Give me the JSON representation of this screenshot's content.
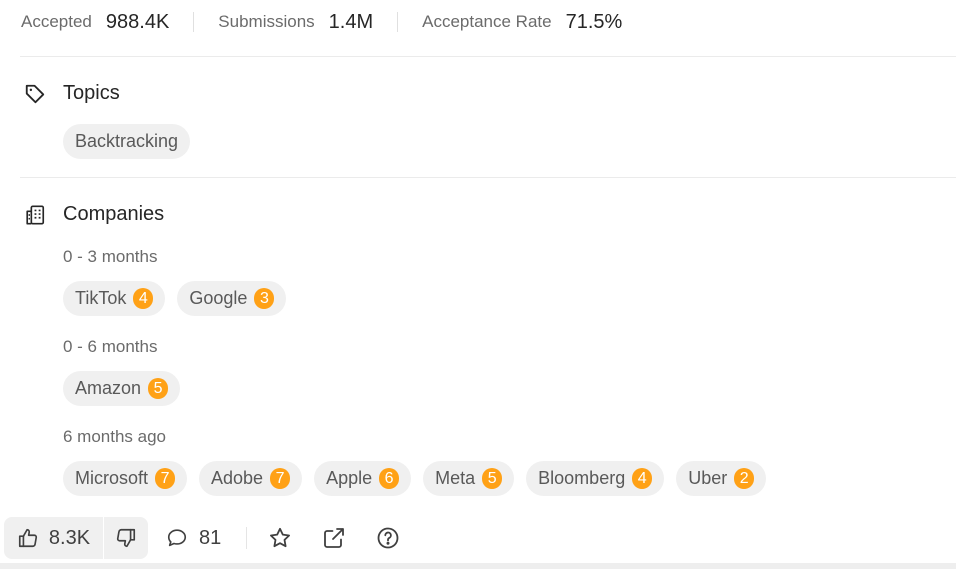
{
  "stats": [
    {
      "label": "Accepted",
      "value": "988.4K"
    },
    {
      "label": "Submissions",
      "value": "1.4M"
    },
    {
      "label": "Acceptance Rate",
      "value": "71.5%"
    }
  ],
  "topics": {
    "title": "Topics",
    "icon": "tag-icon",
    "tags": [
      "Backtracking"
    ]
  },
  "companies": {
    "title": "Companies",
    "icon": "building-icon",
    "groups": [
      {
        "period": "0 - 3 months",
        "items": [
          {
            "name": "TikTok",
            "count": "4"
          },
          {
            "name": "Google",
            "count": "3"
          }
        ]
      },
      {
        "period": "0 - 6 months",
        "items": [
          {
            "name": "Amazon",
            "count": "5"
          }
        ]
      },
      {
        "period": "6 months ago",
        "items": [
          {
            "name": "Microsoft",
            "count": "7"
          },
          {
            "name": "Adobe",
            "count": "7"
          },
          {
            "name": "Apple",
            "count": "6"
          },
          {
            "name": "Meta",
            "count": "5"
          },
          {
            "name": "Bloomberg",
            "count": "4"
          },
          {
            "name": "Uber",
            "count": "2"
          }
        ]
      }
    ]
  },
  "footer": {
    "likes": "8.3K",
    "comments": "81",
    "icons": [
      "thumbs-up-icon",
      "thumbs-down-icon",
      "comment-icon",
      "star-icon",
      "share-icon",
      "help-icon"
    ]
  },
  "colors": {
    "badge": "#ffa116",
    "chip": "#f0f0f0",
    "text": "#262626",
    "muted": "#6b6b6b"
  }
}
